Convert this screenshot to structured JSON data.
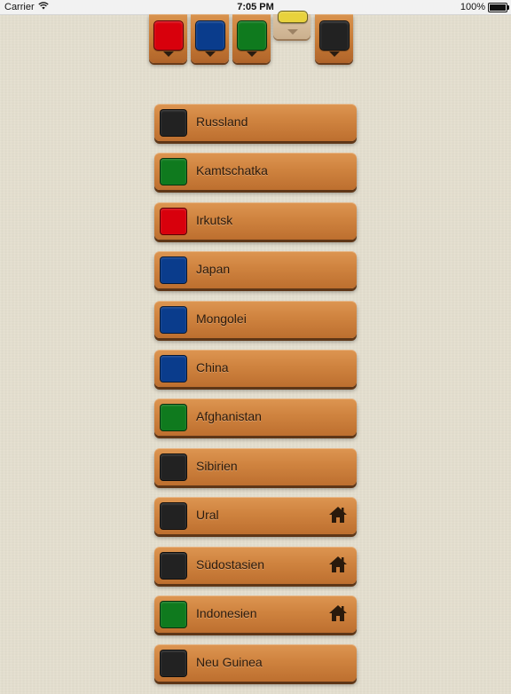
{
  "status_bar": {
    "carrier": "Carrier",
    "time": "7:05 PM",
    "battery": "100%"
  },
  "palette": {
    "swatches": [
      {
        "color": "#d8000c",
        "selected": false
      },
      {
        "color": "#0a3c8c",
        "selected": false
      },
      {
        "color": "#0f7a1e",
        "selected": false
      },
      {
        "color": "#e8d23c",
        "selected": true
      },
      {
        "color": "#222222",
        "selected": false
      }
    ]
  },
  "territories": [
    {
      "label": "Russland",
      "color": "#222222",
      "home": false
    },
    {
      "label": "Kamtschatka",
      "color": "#0f7a1e",
      "home": false
    },
    {
      "label": "Irkutsk",
      "color": "#d8000c",
      "home": false
    },
    {
      "label": "Japan",
      "color": "#0a3c8c",
      "home": false
    },
    {
      "label": "Mongolei",
      "color": "#0a3c8c",
      "home": false
    },
    {
      "label": "China",
      "color": "#0a3c8c",
      "home": false
    },
    {
      "label": "Afghanistan",
      "color": "#0f7a1e",
      "home": false
    },
    {
      "label": "Sibirien",
      "color": "#222222",
      "home": false
    },
    {
      "label": "Ural",
      "color": "#222222",
      "home": true
    },
    {
      "label": "Südostasien",
      "color": "#222222",
      "home": true
    },
    {
      "label": "Indonesien",
      "color": "#0f7a1e",
      "home": true
    },
    {
      "label": "Neu Guinea",
      "color": "#222222",
      "home": false
    }
  ],
  "icons": {
    "home": "home-icon",
    "wifi": "wifi-icon",
    "battery": "battery-icon",
    "dropdown": "chevron-down-icon"
  }
}
